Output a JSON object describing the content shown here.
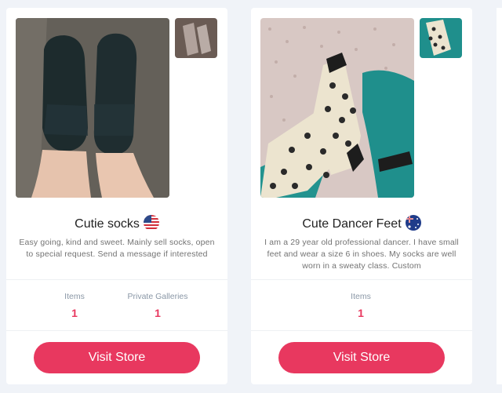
{
  "sellers": [
    {
      "name": "Cutie socks",
      "flag": "us-flag-icon",
      "description": "Easy going, kind and sweet. Mainly sell socks, open to special request. Send a message if interested",
      "stats": [
        {
          "label": "Items",
          "value": "1"
        },
        {
          "label": "Private Galleries",
          "value": "1"
        }
      ],
      "button_label": "Visit Store"
    },
    {
      "name": "Cute Dancer Feet",
      "flag": "au-flag-icon",
      "description": "I am a 29 year old professional dancer. I have small feet and wear a size 6 in shoes. My socks are well worn in a sweaty class. Custom",
      "stats": [
        {
          "label": "Items",
          "value": "1"
        }
      ],
      "button_label": "Visit Store"
    }
  ],
  "colors": {
    "accent": "#e8385f",
    "background": "#f0f3f8",
    "card": "#ffffff",
    "stat_label": "#8a97a6"
  }
}
